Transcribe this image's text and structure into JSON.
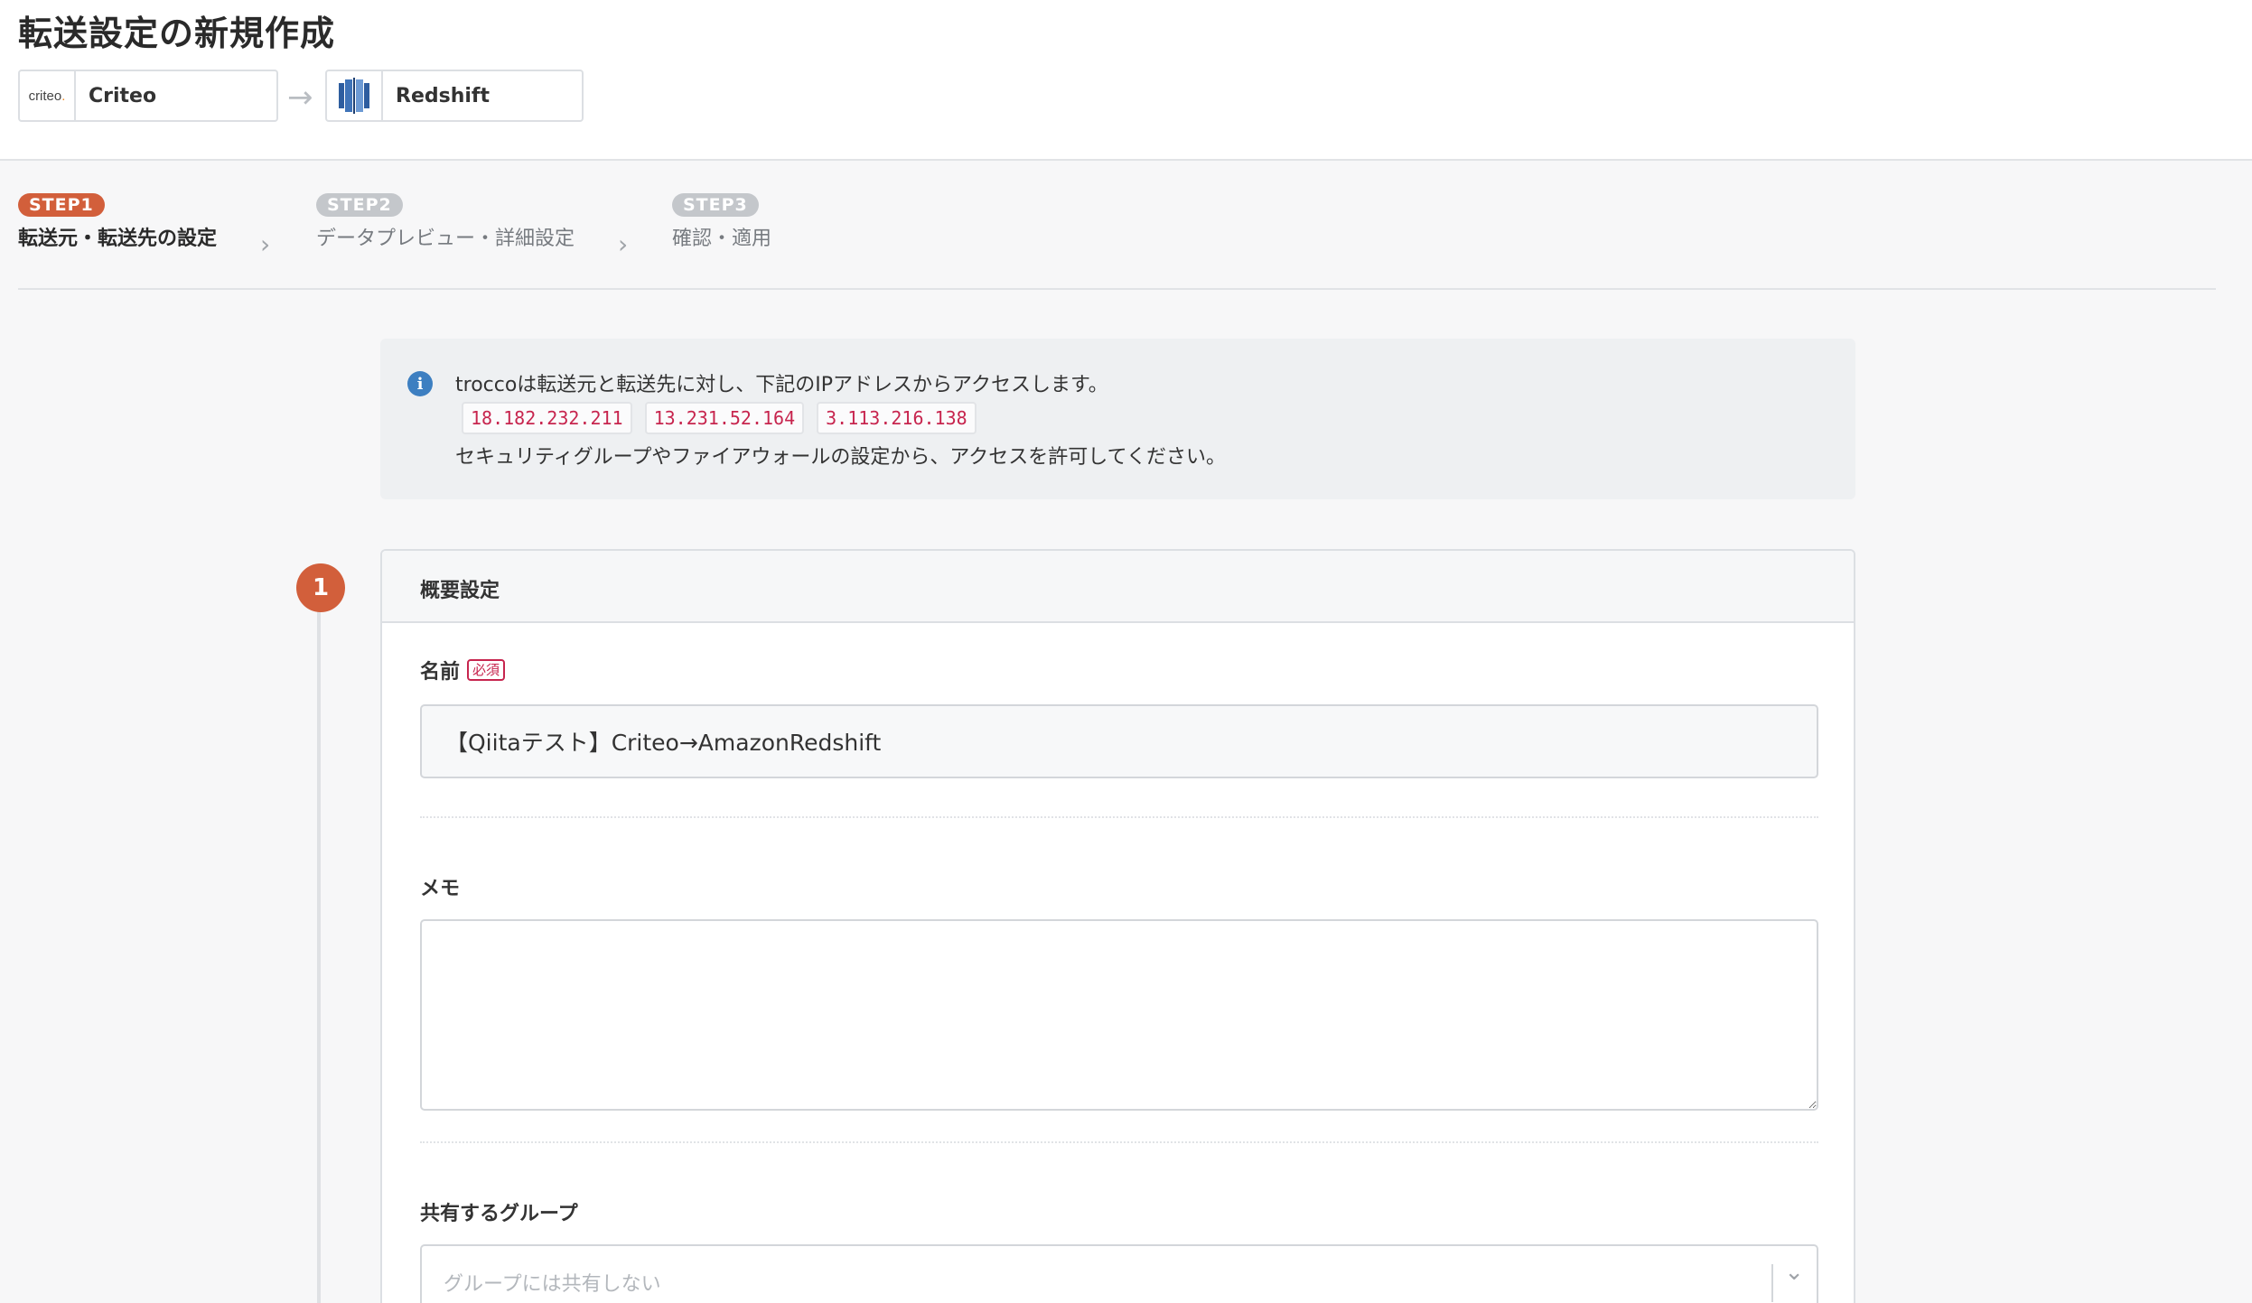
{
  "header": {
    "title": "転送設定の新規作成",
    "source": {
      "logo_text": "criteo",
      "logo_accent": ".",
      "name": "Criteo"
    },
    "destination": {
      "name": "Redshift"
    }
  },
  "steps": [
    {
      "badge": "STEP1",
      "label": "転送元・転送先の設定"
    },
    {
      "badge": "STEP2",
      "label": "データプレビュー・詳細設定"
    },
    {
      "badge": "STEP3",
      "label": "確認・適用"
    }
  ],
  "info": {
    "line1": "troccoは転送元と転送先に対し、下記のIPアドレスからアクセスします。",
    "ips": [
      "18.182.232.211",
      "13.231.52.164",
      "3.113.216.138"
    ],
    "line3": "セキュリティグループやファイアウォールの設定から、アクセスを許可してください。"
  },
  "section": {
    "number": "1",
    "title": "概要設定",
    "name_label": "名前",
    "required": "必須",
    "name_value": "【Qiitaテスト】Criteo→AmazonRedshift",
    "memo_label": "メモ",
    "group_label": "共有するグループ",
    "group_placeholder": "グループには共有しない"
  },
  "colors": {
    "accent": "#d25f3b",
    "info_icon": "#3d7fc1",
    "ip_text": "#c7254e"
  }
}
